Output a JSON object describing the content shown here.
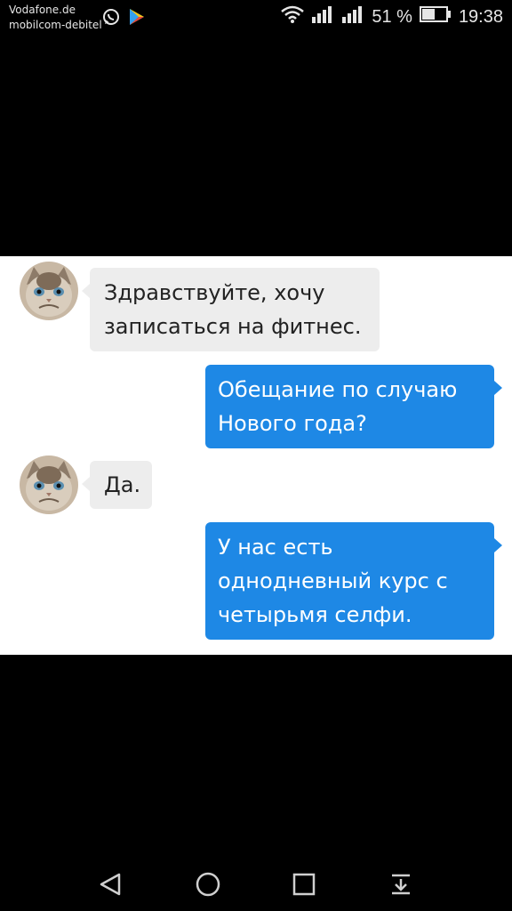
{
  "status_bar": {
    "carrier_line1": "Vodafone.de",
    "carrier_line2": "mobilcom-debitel",
    "notification_icons": [
      "whatsapp-icon",
      "play-store-icon"
    ],
    "battery_percent": "51 %",
    "time": "19:38",
    "status_icons": [
      "wifi-icon",
      "signal-icon",
      "signal-icon",
      "battery-icon"
    ]
  },
  "chat": {
    "messages": [
      {
        "sender": "incoming",
        "lines": [
          "Здравствуйте, хочу",
          "записаться на фитнес."
        ]
      },
      {
        "sender": "outgoing",
        "lines": [
          "Обещание по случаю",
          "Нового года?"
        ]
      },
      {
        "sender": "incoming",
        "lines": [
          "Да."
        ]
      },
      {
        "sender": "outgoing",
        "lines": [
          "У нас есть",
          "однодневный курс с",
          "четырьмя селфи."
        ]
      }
    ],
    "colors": {
      "incoming_bubble": "#ededed",
      "outgoing_bubble": "#1e88e5",
      "panel": "#ffffff"
    }
  },
  "nav_bar": {
    "buttons": [
      "back-icon",
      "home-icon",
      "recents-icon",
      "notification-drawer-icon"
    ]
  }
}
